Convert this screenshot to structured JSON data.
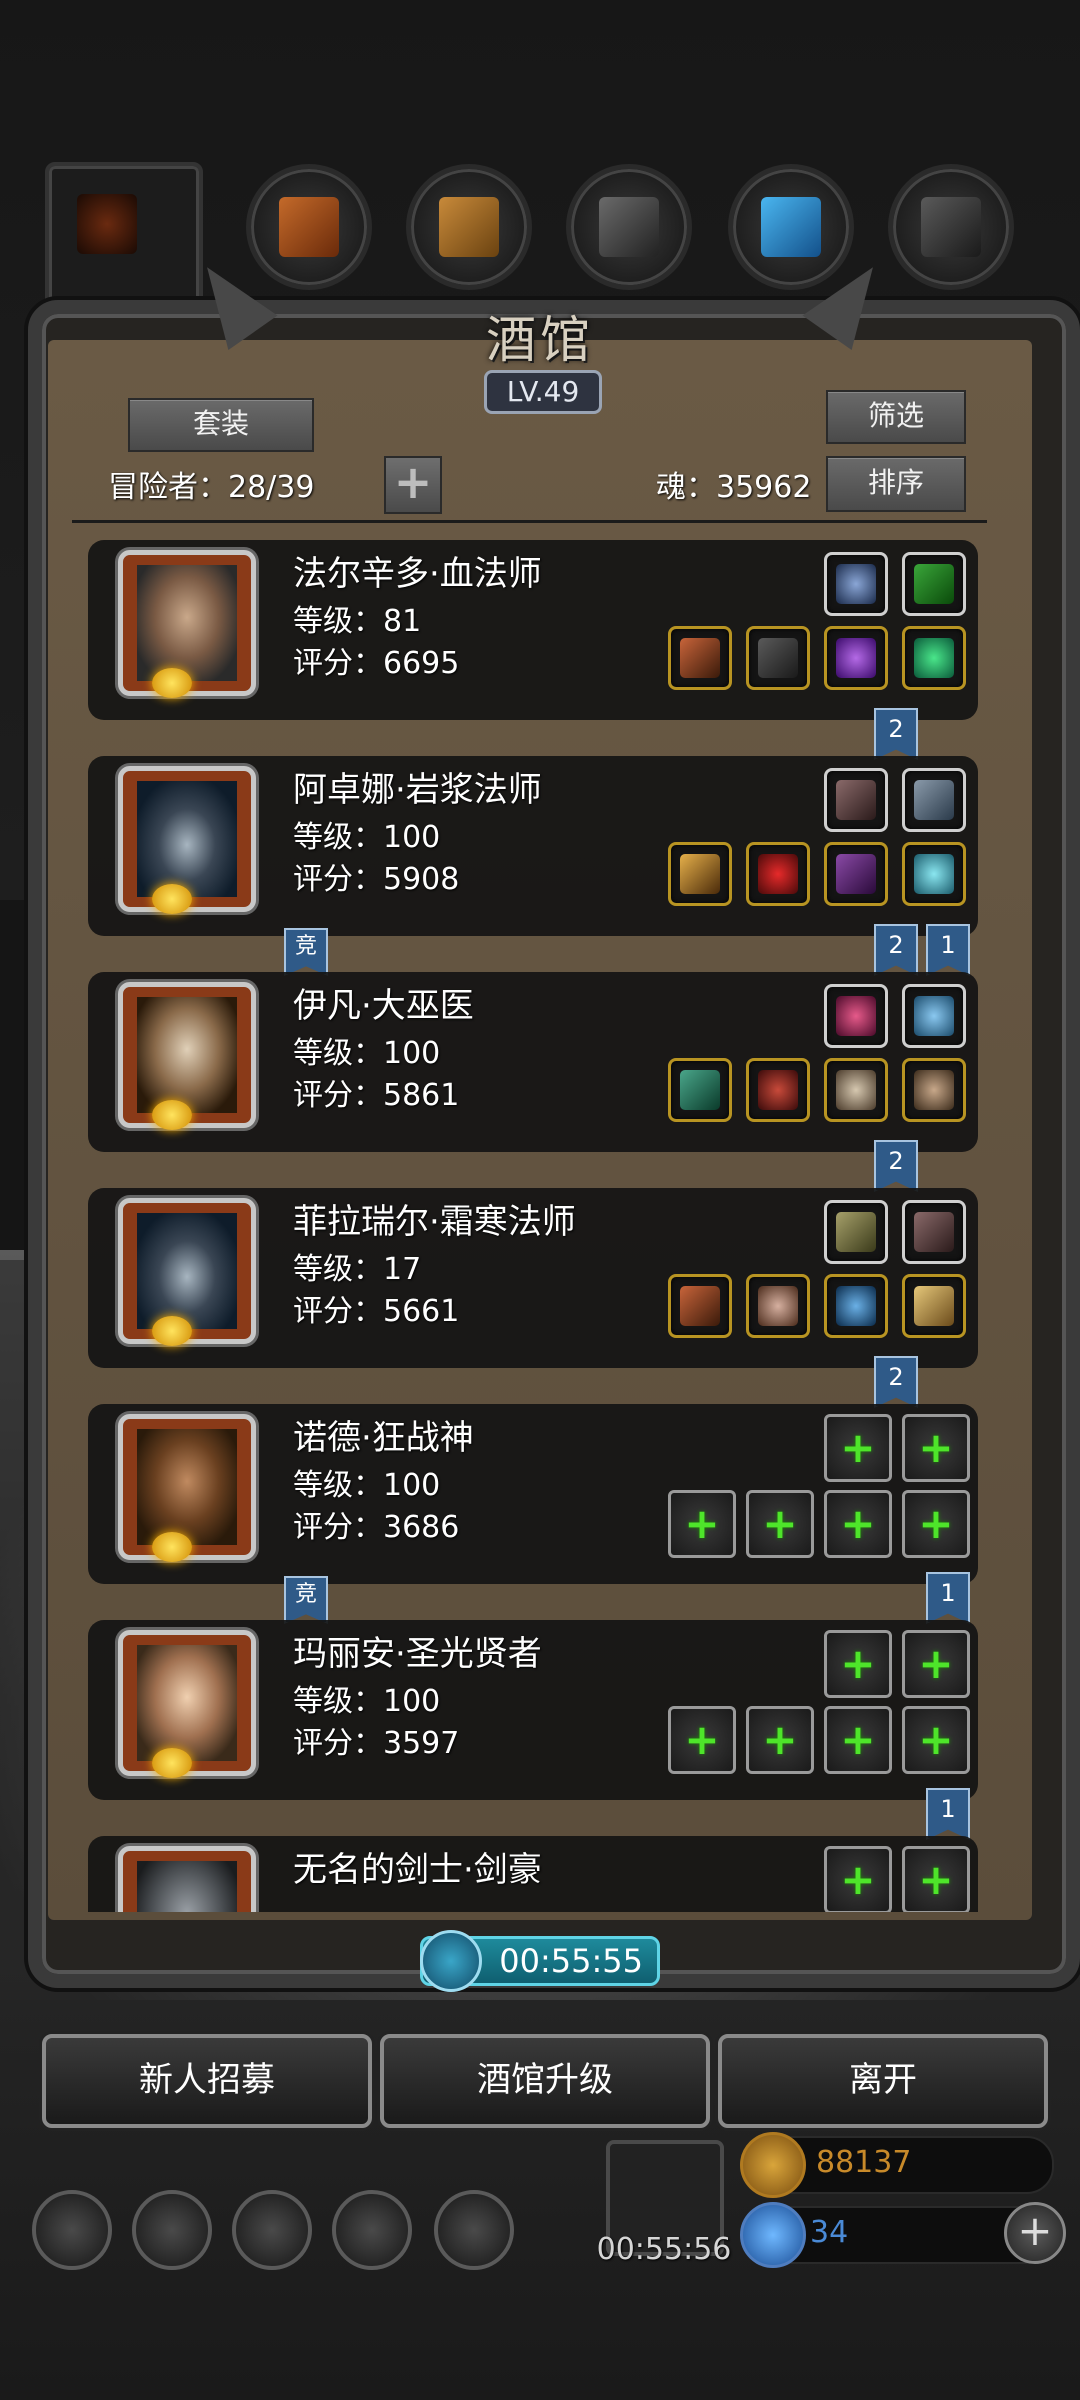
{
  "panel": {
    "title": "酒馆",
    "level": "LV.49",
    "set_button": "套装",
    "filter_button": "筛选",
    "sort_button": "排序",
    "adventurers_label": "冒险者：28/39",
    "soul_label": "魂：35962"
  },
  "heroes": [
    {
      "name": "法尔辛多·血法师",
      "level": "等级：81",
      "score": "评分：6695",
      "flag": "2"
    },
    {
      "name": "阿卓娜·岩浆法师",
      "level": "等级：100",
      "score": "评分：5908",
      "badge": "竞",
      "flags": [
        "2",
        "1"
      ]
    },
    {
      "name": "伊凡·大巫医",
      "level": "等级：100",
      "score": "评分：5861",
      "flag": "2"
    },
    {
      "name": "菲拉瑞尔·霜寒法师",
      "level": "等级：17",
      "score": "评分：5661",
      "flag": "2"
    },
    {
      "name": "诺德·狂战神",
      "level": "等级：100",
      "score": "评分：3686",
      "badge": "竞",
      "flag": "1"
    },
    {
      "name": "玛丽安·圣光贤者",
      "level": "等级：100",
      "score": "评分：3597",
      "flag": "1"
    },
    {
      "name": "无名的剑士·剑豪"
    }
  ],
  "timer": "00:55:55",
  "buttons": {
    "recruit": "新人招募",
    "upgrade": "酒馆升级",
    "leave": "离开"
  },
  "hud": {
    "gift_timer": "00:55:56",
    "gold": "88137",
    "gems": "34"
  },
  "colors": {
    "panel_bg": "#5b4d3b",
    "card_bg": "#141414",
    "slot_gold": "#b89422",
    "flag_blue": "#2f5a88",
    "timer_cyan": "#1e8a9c",
    "plus_green": "#4ee52a"
  }
}
